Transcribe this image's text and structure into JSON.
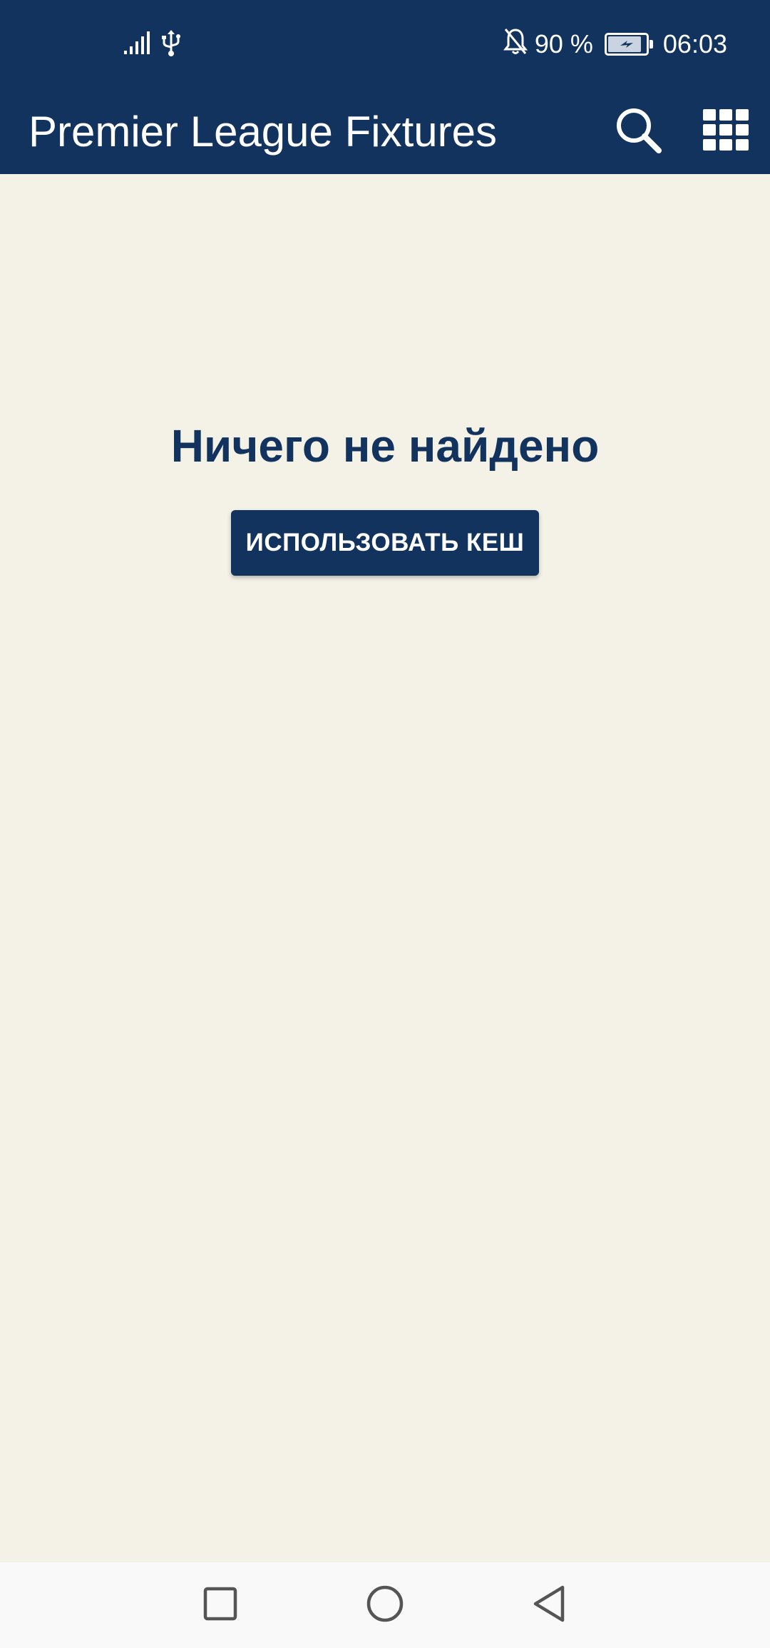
{
  "status_bar": {
    "battery_percent": "90 %",
    "time": "06:03",
    "battery_level": 0.9,
    "icons": [
      "signal-icon",
      "usb-icon",
      "notifications-off-icon",
      "battery-charging-icon"
    ]
  },
  "app_bar": {
    "title": "Premier League Fixtures",
    "actions": [
      "search-icon",
      "grid-menu-icon"
    ]
  },
  "content": {
    "empty_message": "Ничего не найдено",
    "use_cache_label": "ИСПОЛЬЗОВАТЬ КЕШ"
  },
  "nav_bar": {
    "buttons": [
      "recents-square-icon",
      "home-circle-icon",
      "back-triangle-icon"
    ]
  },
  "colors": {
    "primary": "#11335e",
    "background": "#f4f2e7",
    "nav_background": "#f9f9f9",
    "nav_icon": "#555555"
  }
}
